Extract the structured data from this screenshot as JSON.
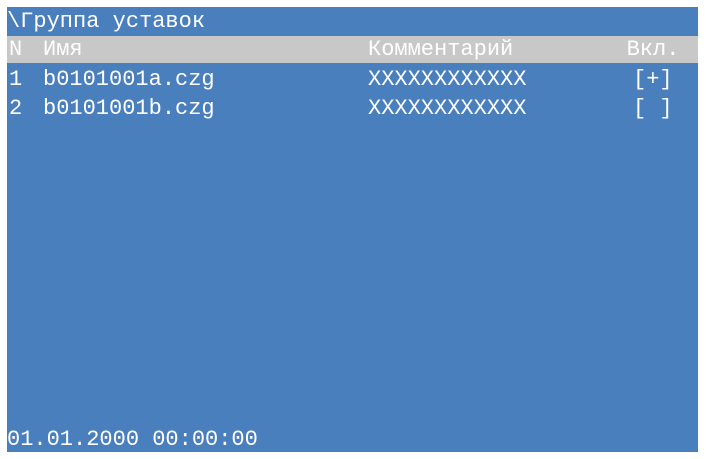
{
  "title": "\\Группа уставок",
  "columns": {
    "n": "N",
    "name": "Имя",
    "comment": "Комментарий",
    "enabled": "Вкл."
  },
  "rows": [
    {
      "n": "1",
      "name": "b0101001a.czg",
      "comment": "XXXXXXXXXXXX",
      "enabled": "[+]"
    },
    {
      "n": "2",
      "name": "b0101001b.czg",
      "comment": "XXXXXXXXXXXX",
      "enabled": "[ ]"
    }
  ],
  "footer": {
    "datetime": "01.01.2000 00:00:00"
  },
  "colors": {
    "background": "#4a7fbd",
    "header": "#c8c8c8",
    "text": "#ffffff"
  }
}
